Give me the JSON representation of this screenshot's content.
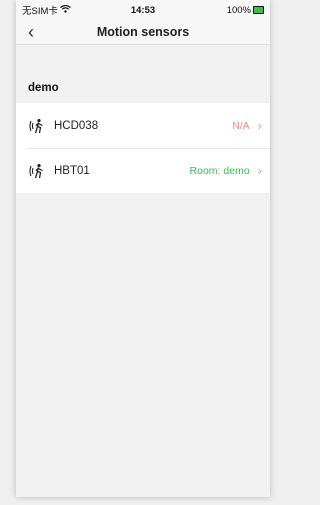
{
  "status_bar": {
    "carrier": "无SIM卡",
    "time": "14:53",
    "battery": "100%"
  },
  "nav": {
    "title": "Motion sensors"
  },
  "section": {
    "title": "demo"
  },
  "sensors": [
    {
      "name": "HCD038",
      "status": "N/A",
      "status_color": "#f08a8a"
    },
    {
      "name": "HBT01",
      "status": "Room: demo",
      "status_color": "#3fb95b"
    }
  ],
  "icons": {
    "sensor": "motion-sensor-icon",
    "chevron": "chevron-right-icon",
    "back": "back-chevron-icon"
  }
}
